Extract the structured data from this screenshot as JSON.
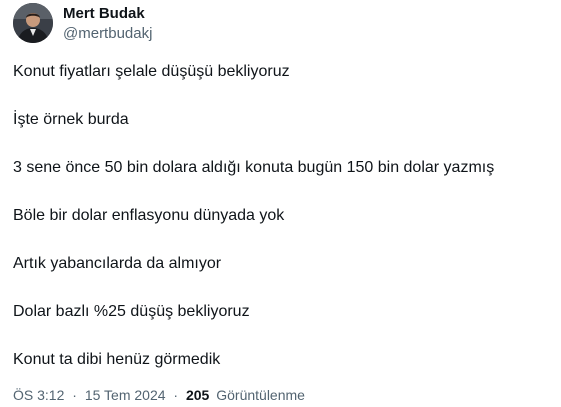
{
  "author": {
    "display_name": "Mert Budak",
    "handle": "@mertbudakj"
  },
  "tweet": {
    "lines": [
      "Konut fiyatları şelale düşüşü bekliyoruz",
      "İşte örnek burda",
      "3 sene önce 50 bin dolara aldığı konuta bugün 150 bin dolar yazmış",
      "Böle bir dolar enflasyonu dünyada yok",
      "Artık yabancılarda da almıyor",
      "Dolar bazlı %25 düşüş bekliyoruz",
      "Konut ta dibi henüz görmedik"
    ]
  },
  "meta": {
    "time": "ÖS 3:12",
    "separator": "·",
    "date": "15 Tem 2024",
    "views_count": "205",
    "views_label": "Görüntülenme"
  },
  "colors": {
    "text_primary": "#0f1419",
    "text_secondary": "#536471",
    "background": "#ffffff"
  }
}
